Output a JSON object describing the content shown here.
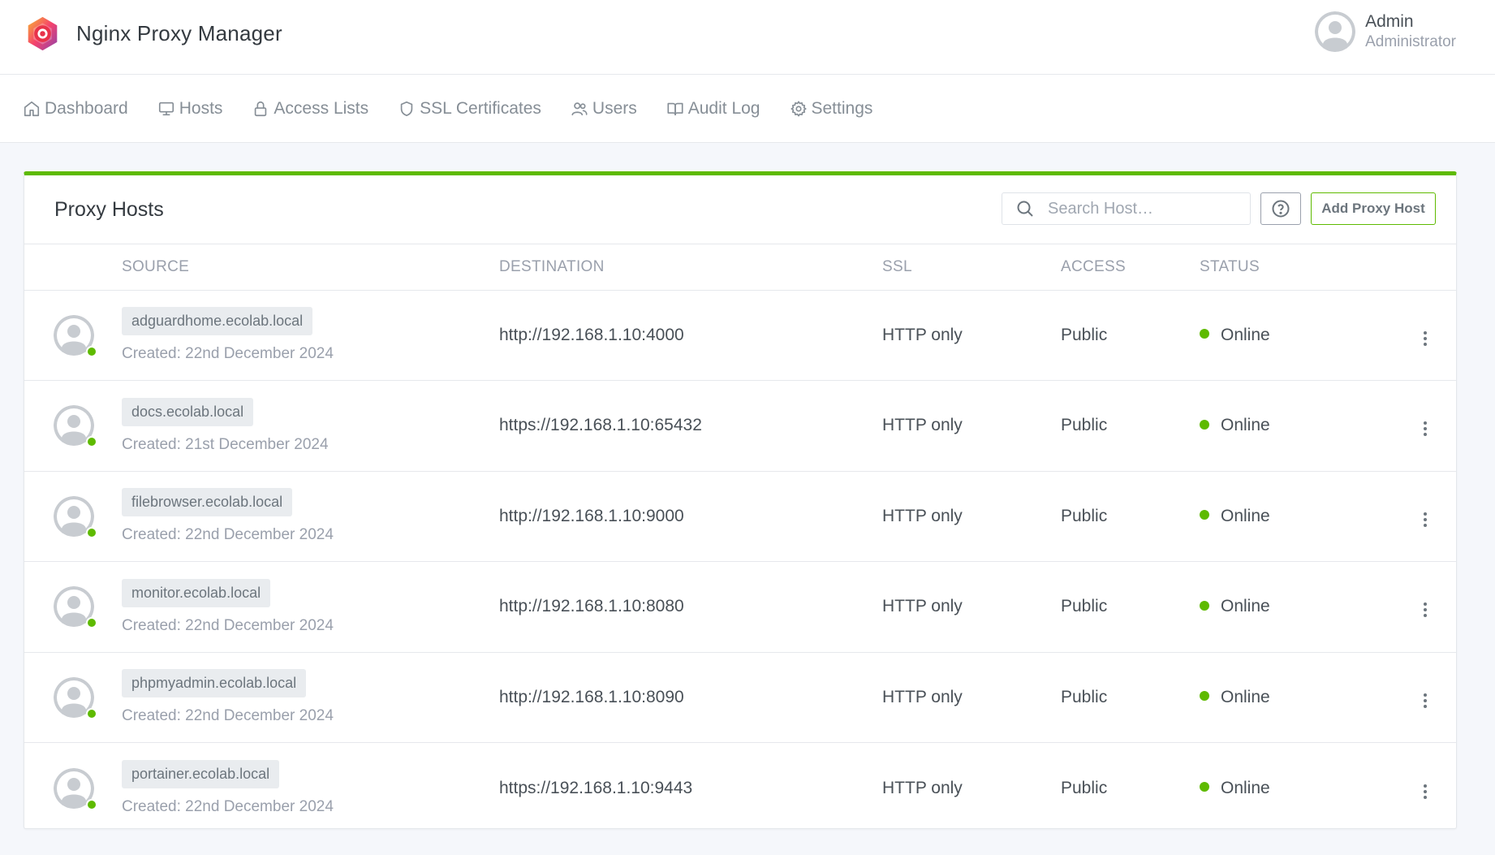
{
  "app": {
    "title": "Nginx Proxy Manager"
  },
  "user": {
    "name": "Admin",
    "role": "Administrator"
  },
  "nav": [
    {
      "label": "Dashboard",
      "icon": "home-icon"
    },
    {
      "label": "Hosts",
      "icon": "monitor-icon"
    },
    {
      "label": "Access Lists",
      "icon": "lock-icon"
    },
    {
      "label": "SSL Certificates",
      "icon": "shield-icon"
    },
    {
      "label": "Users",
      "icon": "users-icon"
    },
    {
      "label": "Audit Log",
      "icon": "book-icon"
    },
    {
      "label": "Settings",
      "icon": "gear-icon"
    }
  ],
  "card": {
    "title": "Proxy Hosts",
    "accent_color": "#5eba00",
    "search_placeholder": "Search Host…",
    "add_button": "Add Proxy Host"
  },
  "table": {
    "columns": [
      "",
      "SOURCE",
      "DESTINATION",
      "SSL",
      "ACCESS",
      "STATUS",
      ""
    ],
    "rows": [
      {
        "domain": "adguardhome.ecolab.local",
        "created": "Created: 22nd December 2024",
        "destination": "http://192.168.1.10:4000",
        "ssl": "HTTP only",
        "access": "Public",
        "status": "Online"
      },
      {
        "domain": "docs.ecolab.local",
        "created": "Created: 21st December 2024",
        "destination": "https://192.168.1.10:65432",
        "ssl": "HTTP only",
        "access": "Public",
        "status": "Online"
      },
      {
        "domain": "filebrowser.ecolab.local",
        "created": "Created: 22nd December 2024",
        "destination": "http://192.168.1.10:9000",
        "ssl": "HTTP only",
        "access": "Public",
        "status": "Online"
      },
      {
        "domain": "monitor.ecolab.local",
        "created": "Created: 22nd December 2024",
        "destination": "http://192.168.1.10:8080",
        "ssl": "HTTP only",
        "access": "Public",
        "status": "Online"
      },
      {
        "domain": "phpmyadmin.ecolab.local",
        "created": "Created: 22nd December 2024",
        "destination": "http://192.168.1.10:8090",
        "ssl": "HTTP only",
        "access": "Public",
        "status": "Online"
      },
      {
        "domain": "portainer.ecolab.local",
        "created": "Created: 22nd December 2024",
        "destination": "https://192.168.1.10:9443",
        "ssl": "HTTP only",
        "access": "Public",
        "status": "Online"
      }
    ]
  }
}
